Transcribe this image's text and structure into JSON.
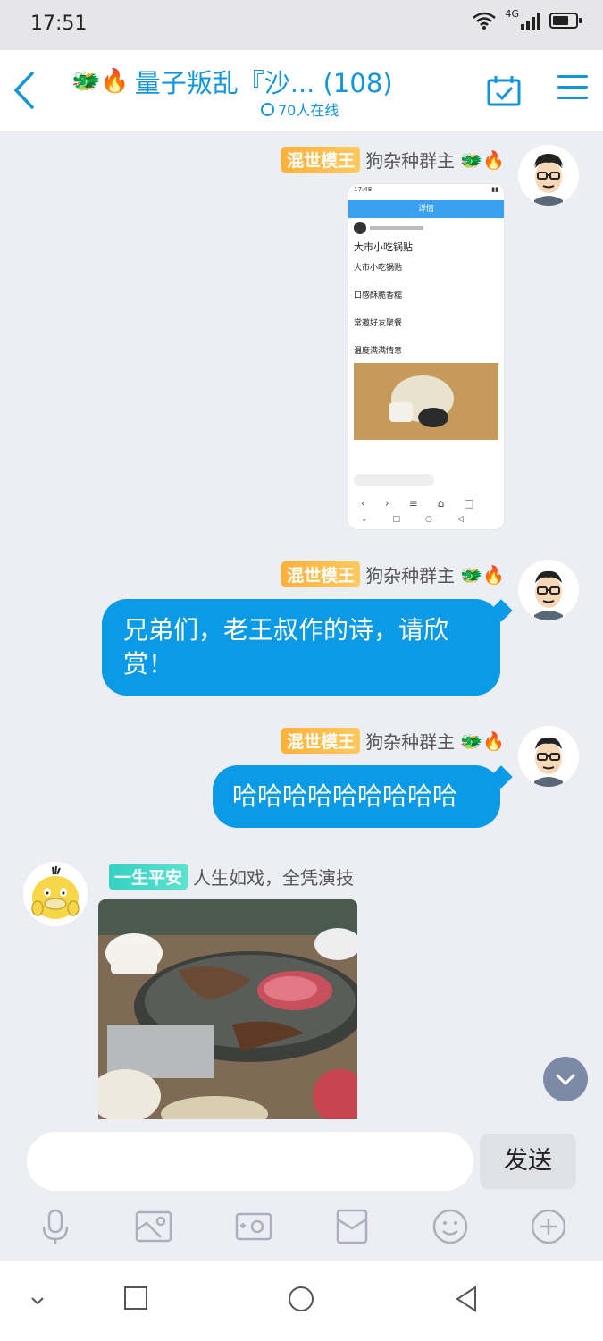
{
  "status_bar": {
    "time": "17:51",
    "network": "4G",
    "battery_level": 0.7
  },
  "header": {
    "back_icon": "chevron-left-icon",
    "title_emoji": "🐲🔥",
    "title": "量子叛乱『沙... (108)",
    "online_text": "70人在线",
    "calendar_icon": "calendar-check-icon",
    "menu_icon": "hamburger-menu-icon",
    "accent_color": "#1296db"
  },
  "messages": [
    {
      "sender": "me",
      "badge": "混世模王",
      "name": "狗杂种群主",
      "name_emoji": "🐲🔥",
      "type": "image",
      "image": {
        "kind": "screenshot",
        "status_time": "17:48",
        "header_title": "详情",
        "post_title": "大市小吃锅贴",
        "post_lines": [
          "大市小吃锅贴",
          "口感酥脆香糯",
          "常邀好友聚餐",
          "温度满满情意"
        ]
      }
    },
    {
      "sender": "me",
      "badge": "混世模王",
      "name": "狗杂种群主",
      "name_emoji": "🐲🔥",
      "type": "text",
      "text": "兄弟们，老王叔作的诗，请欣赏！"
    },
    {
      "sender": "me",
      "badge": "混世模王",
      "name": "狗杂种群主",
      "name_emoji": "🐲🔥",
      "type": "text",
      "text": "哈哈哈哈哈哈哈哈哈"
    },
    {
      "sender": "other",
      "badge": "一生平安",
      "name": "人生如戏，全凭演技",
      "type": "image",
      "image": {
        "kind": "photo",
        "subject": "grilled-meat-on-stone-plate"
      }
    }
  ],
  "input": {
    "placeholder": "",
    "send_label": "发送"
  },
  "toolbar": [
    "microphone-icon",
    "image-icon",
    "camera-icon",
    "red-packet-icon",
    "emoji-icon",
    "plus-circle-icon"
  ],
  "navbar": [
    "collapse-icon",
    "recent-apps-icon",
    "home-icon",
    "back-icon"
  ],
  "colors": {
    "bubble": "#0a9ae6",
    "badge_orange": "#ffb13b",
    "badge_teal": "#33d1c1",
    "background": "#eceef3"
  }
}
